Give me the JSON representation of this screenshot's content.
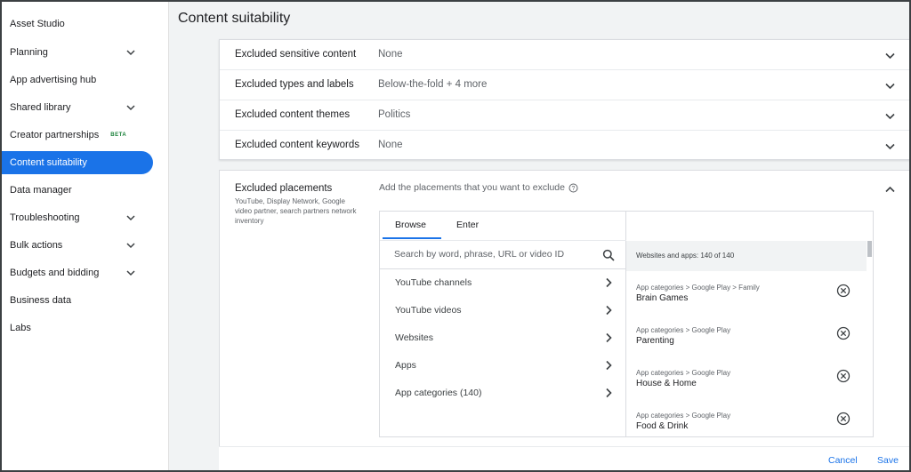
{
  "sidebar": {
    "items": [
      {
        "label": "Asset Studio",
        "chevron": false
      },
      {
        "label": "Planning",
        "chevron": true
      },
      {
        "label": "App advertising hub",
        "chevron": false
      },
      {
        "label": "Shared library",
        "chevron": true
      },
      {
        "label": "Creator partnerships",
        "chevron": false,
        "badge": "BETA"
      },
      {
        "label": "Content suitability",
        "chevron": false,
        "active": true
      },
      {
        "label": "Data manager",
        "chevron": false
      },
      {
        "label": "Troubleshooting",
        "chevron": true
      },
      {
        "label": "Bulk actions",
        "chevron": true
      },
      {
        "label": "Budgets and bidding",
        "chevron": true
      },
      {
        "label": "Business data",
        "chevron": false
      },
      {
        "label": "Labs",
        "chevron": false
      }
    ]
  },
  "page": {
    "title": "Content suitability"
  },
  "settings": [
    {
      "label": "Excluded sensitive content",
      "value": "None"
    },
    {
      "label": "Excluded types and labels",
      "value": "Below-the-fold + 4 more"
    },
    {
      "label": "Excluded content themes",
      "value": "Politics"
    },
    {
      "label": "Excluded content keywords",
      "value": "None"
    }
  ],
  "placements": {
    "title": "Excluded placements",
    "description": "YouTube, Display Network, Google video partner, search partners network inventory",
    "prompt": "Add the placements that you want to exclude",
    "tabs": {
      "browse": "Browse",
      "enter": "Enter"
    },
    "search": {
      "placeholder": "Search by word, phrase, URL or video ID",
      "value": ""
    },
    "categories": [
      {
        "label": "YouTube channels"
      },
      {
        "label": "YouTube videos"
      },
      {
        "label": "Websites"
      },
      {
        "label": "Apps"
      },
      {
        "label": "App categories (140)"
      }
    ],
    "selected_header": "Websites and apps: 140 of 140",
    "selected": [
      {
        "path": "App categories > Google Play > Family",
        "name": "Brain Games"
      },
      {
        "path": "App categories > Google Play",
        "name": "Parenting"
      },
      {
        "path": "App categories > Google Play",
        "name": "House & Home"
      },
      {
        "path": "App categories > Google Play",
        "name": "Food & Drink"
      }
    ]
  },
  "footer": {
    "cancel": "Cancel",
    "save": "Save"
  },
  "colors": {
    "accent": "#1a73e8",
    "beta": "#188038",
    "background": "#f1f3f4"
  }
}
